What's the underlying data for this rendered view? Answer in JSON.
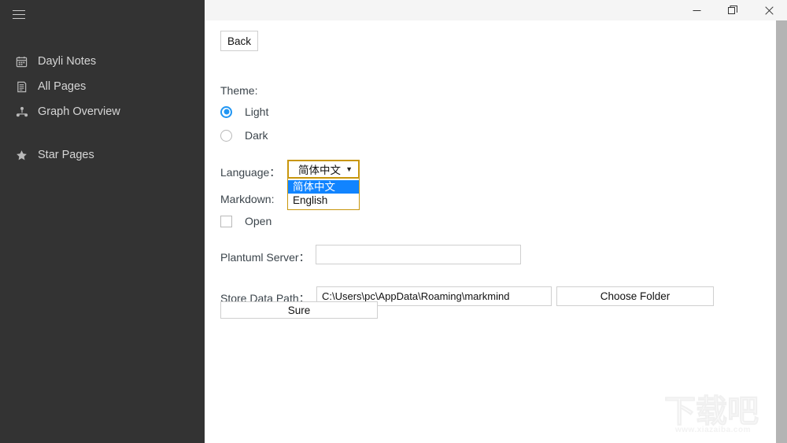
{
  "window": {
    "controls": [
      {
        "name": "minimize",
        "label": "Minimize"
      },
      {
        "name": "restore",
        "label": "Restore"
      },
      {
        "name": "close",
        "label": "Close"
      }
    ]
  },
  "sidebar": {
    "menu_icon": "hamburger-icon",
    "primary_items": [
      {
        "icon": "calendar-icon",
        "label": "Dayli Notes"
      },
      {
        "icon": "document-icon",
        "label": "All Pages"
      },
      {
        "icon": "graph-icon",
        "label": "Graph Overview"
      }
    ],
    "secondary_items": [
      {
        "icon": "star-icon",
        "label": "Star Pages"
      }
    ]
  },
  "settings": {
    "back_label": "Back",
    "theme_label": "Theme:",
    "theme_options": [
      {
        "label": "Light",
        "checked": true
      },
      {
        "label": "Dark",
        "checked": false
      }
    ],
    "language_label": "Language：",
    "language_value": "简体中文",
    "language_options": [
      {
        "label": "简体中文",
        "selected": true
      },
      {
        "label": "English",
        "selected": false
      }
    ],
    "dropdown_arrow": "▼",
    "markdown_label": "Markdown:",
    "markdown_open_label": "Open",
    "markdown_open_checked": false,
    "plantuml_label": "Plantuml Server：",
    "plantuml_value": "",
    "plantuml_placeholder": "",
    "store_path_label": "Store Data Path：",
    "store_path_value": "C:\\Users\\pc\\AppData\\Roaming\\markmind",
    "choose_folder_label": "Choose Folder",
    "sure_label": "Sure"
  },
  "watermark": {
    "title": "下载吧",
    "url": "www.xiazaiba.com"
  },
  "colors": {
    "sidebar_bg": "#333333",
    "accent_blue": "#2196f3",
    "highlight_blue": "#1184ff",
    "focus_gold": "#c8960c",
    "titlebar_bg": "#f5f5f5",
    "scrollbar": "#b4b4b4"
  }
}
